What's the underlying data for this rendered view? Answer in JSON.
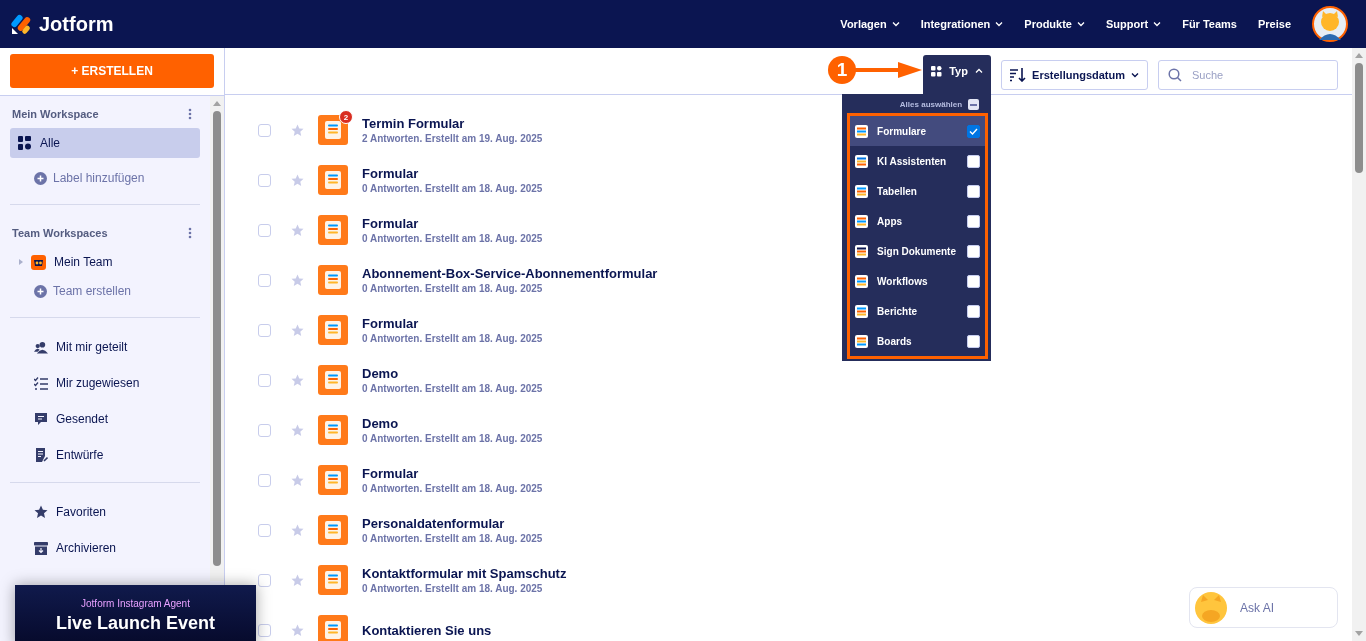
{
  "header": {
    "logo": "Jotform",
    "nav": [
      {
        "label": "Vorlagen",
        "dropdown": true
      },
      {
        "label": "Integrationen",
        "dropdown": true
      },
      {
        "label": "Produkte",
        "dropdown": true
      },
      {
        "label": "Support",
        "dropdown": true
      },
      {
        "label": "Für Teams",
        "dropdown": false
      },
      {
        "label": "Preise",
        "dropdown": false
      }
    ]
  },
  "sidebar": {
    "create_button": "+ ERSTELLEN",
    "groups": [
      {
        "title": "Mein Workspace",
        "items": [
          {
            "kind": "nav",
            "label": "Alle",
            "selected": true
          },
          {
            "kind": "add",
            "label": "Label hinzufügen"
          }
        ]
      },
      {
        "title": "Team Workspaces",
        "items": [
          {
            "kind": "team",
            "label": "Mein Team",
            "expanded": false
          },
          {
            "kind": "add",
            "label": "Team erstellen"
          }
        ]
      },
      {
        "items": [
          {
            "kind": "nav",
            "label": "Mit mir geteilt",
            "selected": false
          },
          {
            "kind": "nav",
            "label": "Mir zugewiesen",
            "selected": false
          },
          {
            "kind": "nav",
            "label": "Gesendet",
            "selected": false
          },
          {
            "kind": "nav",
            "label": "Entwürfe",
            "selected": false
          }
        ]
      },
      {
        "items": [
          {
            "kind": "nav",
            "label": "Favoriten",
            "selected": false
          },
          {
            "kind": "nav",
            "label": "Archivieren",
            "selected": false
          }
        ]
      }
    ]
  },
  "toolbar": {
    "type_filter": {
      "label": "Typ",
      "expanded": true
    },
    "sort": {
      "label": "Erstellungsdatum"
    },
    "search": {
      "placeholder": "Suche"
    }
  },
  "annotation": {
    "step": "1"
  },
  "type_menu": {
    "select_all": {
      "label": "Alles auswählen",
      "indeterminate": true
    },
    "options": [
      {
        "label": "Formulare",
        "checked": true,
        "selected": true
      },
      {
        "label": "KI Assistenten",
        "checked": false,
        "selected": false
      },
      {
        "label": "Tabellen",
        "checked": false,
        "selected": false
      },
      {
        "label": "Apps",
        "checked": false,
        "selected": false
      },
      {
        "label": "Sign Dokumente",
        "checked": false,
        "selected": false
      },
      {
        "label": "Workflows",
        "checked": false,
        "selected": false
      },
      {
        "label": "Berichte",
        "checked": false,
        "selected": false
      },
      {
        "label": "Boards",
        "checked": false,
        "selected": false
      }
    ]
  },
  "forms": [
    {
      "title": "Termin Formular",
      "meta": "2 Antworten. Erstellt am 19. Aug. 2025",
      "badge": "2",
      "checked": false,
      "starred": false
    },
    {
      "title": "Formular",
      "meta": "0 Antworten. Erstellt am 18. Aug. 2025",
      "checked": false,
      "starred": false
    },
    {
      "title": "Formular",
      "meta": "0 Antworten. Erstellt am 18. Aug. 2025",
      "checked": false,
      "starred": false
    },
    {
      "title": "Abonnement-Box-Service-Abonnementformular",
      "meta": "0 Antworten. Erstellt am 18. Aug. 2025",
      "checked": false,
      "starred": false
    },
    {
      "title": "Formular",
      "meta": "0 Antworten. Erstellt am 18. Aug. 2025",
      "checked": false,
      "starred": false
    },
    {
      "title": "Demo",
      "meta": "0 Antworten. Erstellt am 18. Aug. 2025",
      "checked": false,
      "starred": false
    },
    {
      "title": "Demo",
      "meta": "0 Antworten. Erstellt am 18. Aug. 2025",
      "checked": false,
      "starred": false
    },
    {
      "title": "Formular",
      "meta": "0 Antworten. Erstellt am 18. Aug. 2025",
      "checked": false,
      "starred": false
    },
    {
      "title": "Personaldatenformular",
      "meta": "0 Antworten. Erstellt am 18. Aug. 2025",
      "checked": false,
      "starred": false
    },
    {
      "title": "Kontaktformular mit Spamschutz",
      "meta": "0 Antworten. Erstellt am 18. Aug. 2025",
      "checked": false,
      "starred": false
    },
    {
      "title": "Kontaktieren Sie uns",
      "checked": false,
      "starred": false
    }
  ],
  "promo": {
    "eyebrow": "Jotform Instagram Agent",
    "headline": "Live Launch Event"
  },
  "ask_ai": {
    "label": "Ask AI"
  }
}
